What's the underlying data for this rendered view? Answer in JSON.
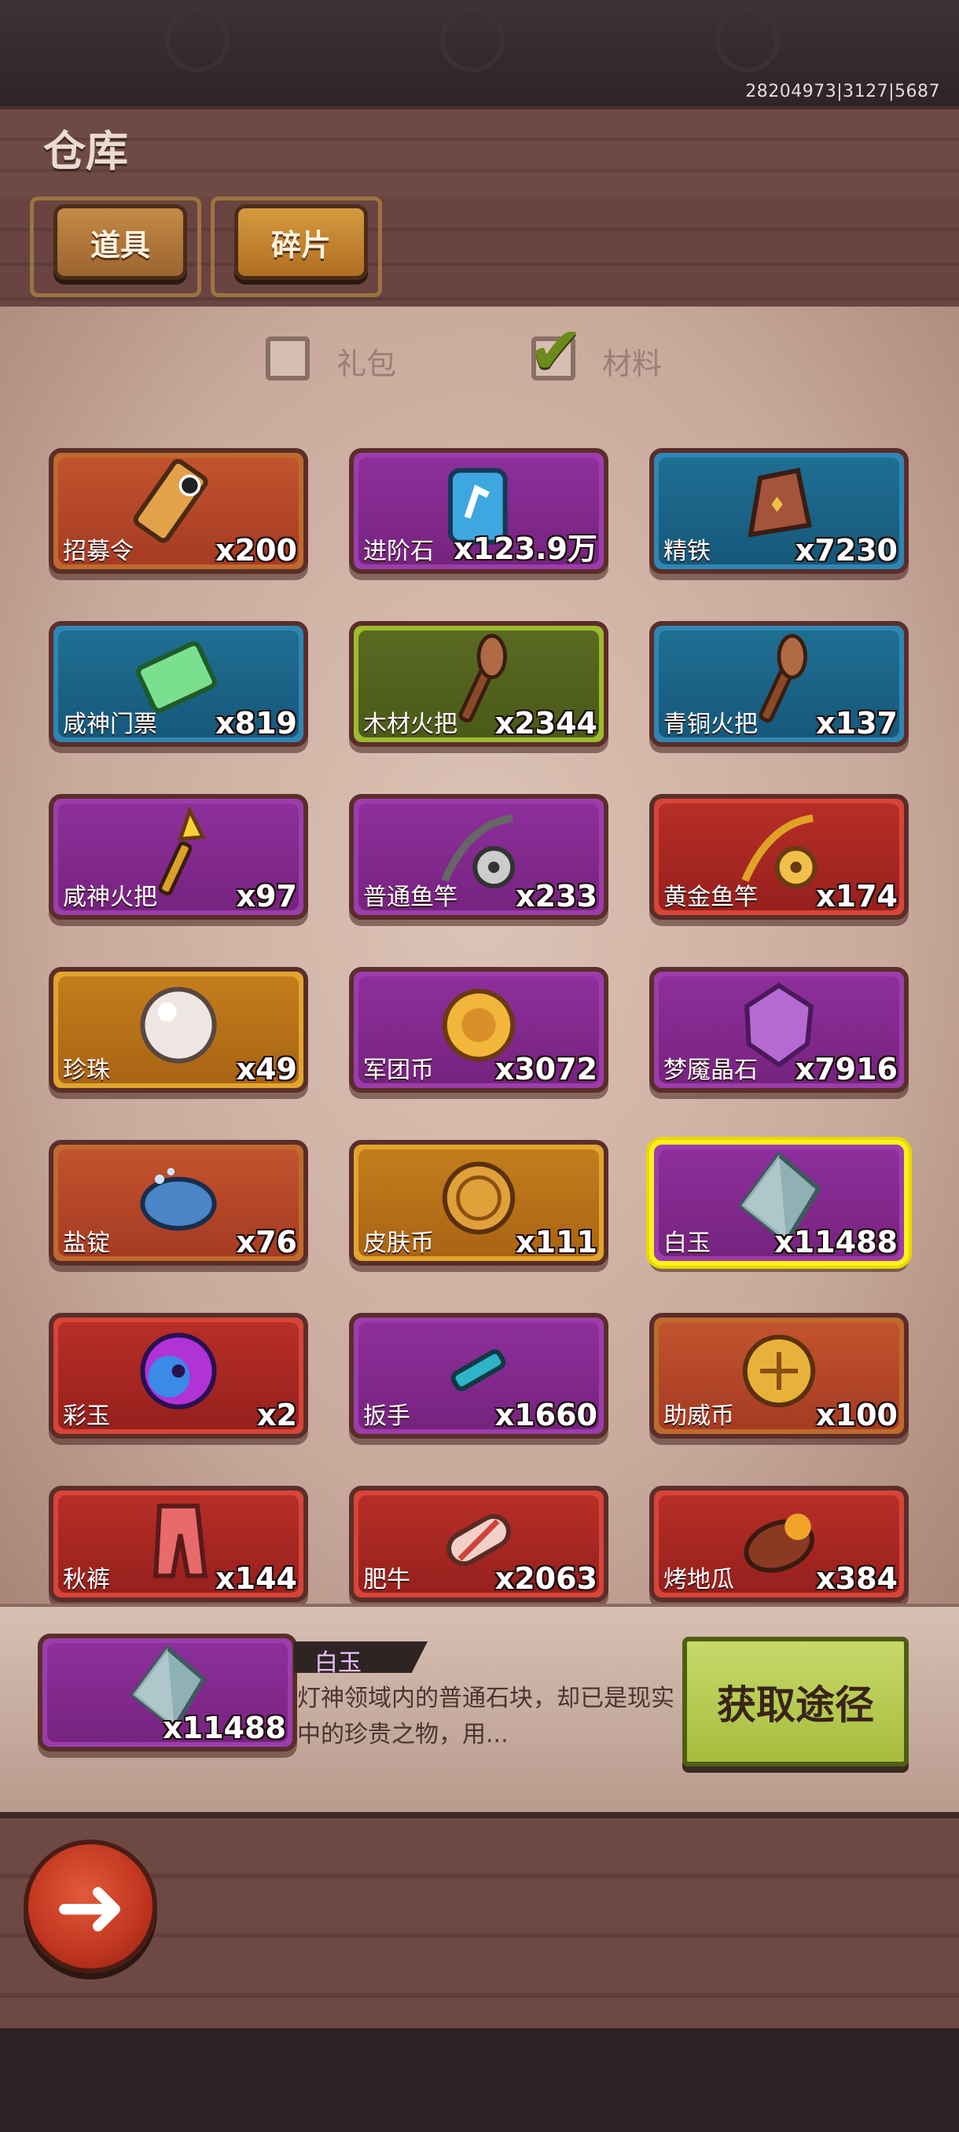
{
  "status": {
    "build_id": "28204973|3127|5687"
  },
  "header": {
    "title": "仓库"
  },
  "tabs": [
    {
      "label": "道具"
    },
    {
      "label": "碎片"
    }
  ],
  "filters": [
    {
      "label": "礼包",
      "checked": false
    },
    {
      "label": "材料",
      "checked": true
    }
  ],
  "items": [
    {
      "name": "招募令",
      "qty": "x200",
      "rarity": "orange",
      "icon": "scroll-icon"
    },
    {
      "name": "进阶石",
      "qty": "x123.9万",
      "rarity": "purple",
      "icon": "rune-stone-icon"
    },
    {
      "name": "精铁",
      "qty": "x7230",
      "rarity": "blue",
      "icon": "iron-ingot-icon"
    },
    {
      "name": "咸神门票",
      "qty": "x819",
      "rarity": "blue",
      "icon": "ticket-icon"
    },
    {
      "name": "木材火把",
      "qty": "x2344",
      "rarity": "green",
      "icon": "torch-icon"
    },
    {
      "name": "青铜火把",
      "qty": "x137",
      "rarity": "blue",
      "icon": "torch-icon"
    },
    {
      "name": "咸神火把",
      "qty": "x97",
      "rarity": "purple",
      "icon": "golden-torch-icon"
    },
    {
      "name": "普通鱼竿",
      "qty": "x233",
      "rarity": "purple",
      "icon": "fishing-rod-icon"
    },
    {
      "name": "黄金鱼竿",
      "qty": "x174",
      "rarity": "red",
      "icon": "golden-fishing-rod-icon"
    },
    {
      "name": "珍珠",
      "qty": "x49",
      "rarity": "gold",
      "icon": "pearl-icon"
    },
    {
      "name": "军团币",
      "qty": "x3072",
      "rarity": "purple",
      "icon": "legion-coin-icon"
    },
    {
      "name": "梦魇晶石",
      "qty": "x7916",
      "rarity": "purple",
      "icon": "crystal-icon"
    },
    {
      "name": "盐锭",
      "qty": "x76",
      "rarity": "orange",
      "icon": "salt-ingot-icon"
    },
    {
      "name": "皮肤币",
      "qty": "x111",
      "rarity": "gold",
      "icon": "skin-coin-icon"
    },
    {
      "name": "白玉",
      "qty": "x11488",
      "rarity": "selected",
      "icon": "white-jade-icon"
    },
    {
      "name": "彩玉",
      "qty": "x2",
      "rarity": "red",
      "icon": "colored-jade-icon"
    },
    {
      "name": "扳手",
      "qty": "x1660",
      "rarity": "purple",
      "icon": "wrench-icon"
    },
    {
      "name": "助威币",
      "qty": "x100",
      "rarity": "orange",
      "icon": "cheer-coin-icon"
    },
    {
      "name": "秋裤",
      "qty": "x144",
      "rarity": "red",
      "icon": "long-johns-icon"
    },
    {
      "name": "肥牛",
      "qty": "x2063",
      "rarity": "red",
      "icon": "beef-roll-icon"
    },
    {
      "name": "烤地瓜",
      "qty": "x384",
      "rarity": "red",
      "icon": "sweet-potato-icon"
    }
  ],
  "detail": {
    "name": "白玉",
    "qty": "x11488",
    "desc": "灯神领域内的普通石块，却已是现实中的珍贵之物，用...",
    "get_button": "获取途径"
  }
}
